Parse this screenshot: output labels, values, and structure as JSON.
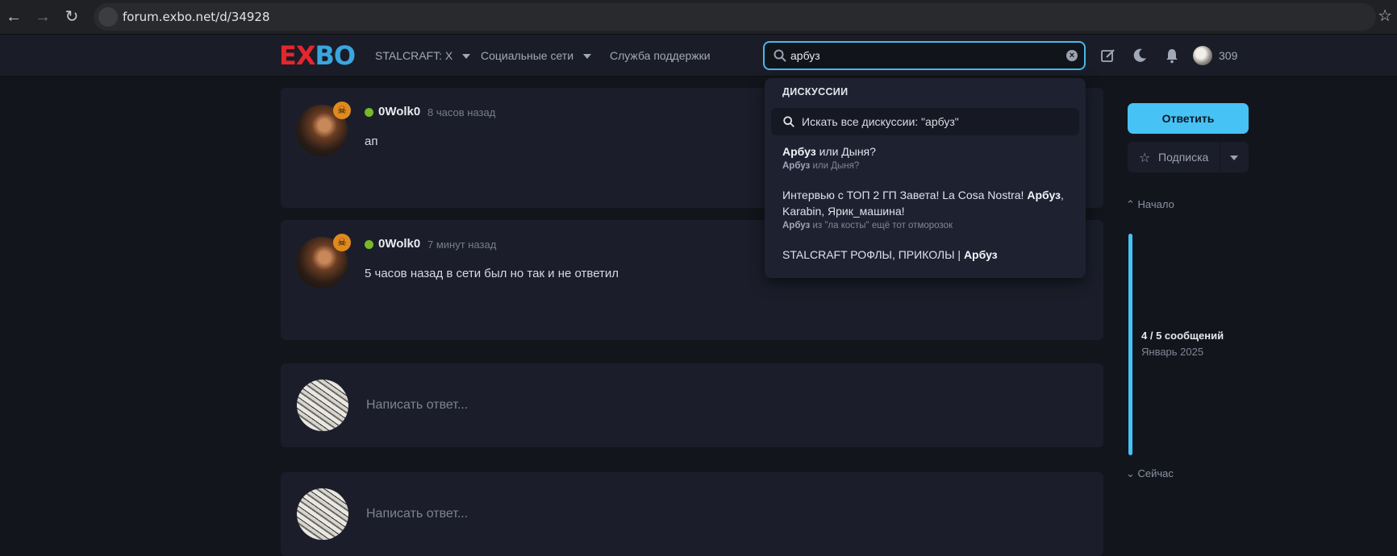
{
  "browser": {
    "url": "forum.exbo.net/d/34928"
  },
  "header": {
    "logo": {
      "e": "E",
      "x": "X",
      "bo": "BO"
    },
    "nav": [
      {
        "label": "STALCRAFT: X",
        "dropdown": true
      },
      {
        "label": "Социальные сети",
        "dropdown": true
      },
      {
        "label": "Служба поддержки",
        "dropdown": false
      }
    ],
    "search_value": "арбуз",
    "user_count": "309"
  },
  "posts": [
    {
      "username": "0Wolk0",
      "time": "8 часов назад",
      "body": "ап"
    },
    {
      "username": "0Wolk0",
      "time": "7 минут назад",
      "body": "5 часов назад в сети был но так и не ответил"
    }
  ],
  "reply_placeholder": "Написать ответ...",
  "search_dropdown": {
    "heading": "ДИСКУССИИ",
    "search_all": "Искать все дискуссии: \"арбуз\"",
    "results": [
      {
        "title_bold": "Арбуз",
        "title_rest": " или Дыня?",
        "sub_bold": "Арбуз",
        "sub_rest": " или Дыня?"
      },
      {
        "title_pre": "Интервью с ТОП 2 ГП Завета! La Cosa Nostra! ",
        "title_bold": "Арбуз",
        "title_post": ", Karabin, Ярик_машина!",
        "sub_bold": "Арбуз",
        "sub_rest": " из \"ла косты\" ещё тот отморозок"
      },
      {
        "title_pre": "STALCRAFT РОФЛЫ, ПРИКОЛЫ | ",
        "title_bold": "Арбуз"
      }
    ]
  },
  "sidebar": {
    "reply_button": "Ответить",
    "subscribe_button": "Подписка",
    "scrubber_start": "Начало",
    "scrubber_count": "4 / 5 сообщений",
    "scrubber_date": "Январь 2025",
    "scrubber_end": "Сейчас"
  },
  "colors": {
    "accent": "#46c2f5",
    "online": "#78b82a",
    "badge": "#e08a1e",
    "logo_red": "#e5262d",
    "logo_blue": "#3aa6e0"
  }
}
